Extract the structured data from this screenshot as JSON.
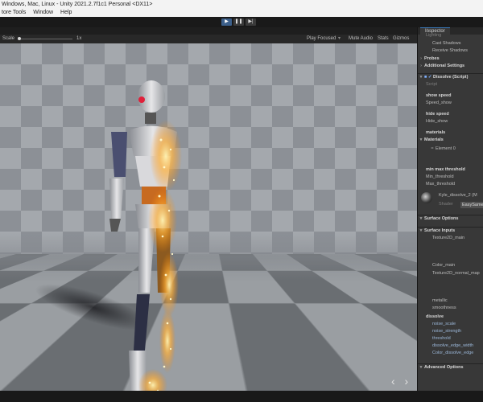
{
  "window": {
    "title": "Windows, Mac, Linux - Unity 2021.2.7f1c1 Personal <DX11>"
  },
  "menu": {
    "items": [
      "tore Tools",
      "Window",
      "Help"
    ]
  },
  "toolbar": {
    "play_icon": "▶",
    "pause_icon": "❚❚",
    "step_icon": "▶|"
  },
  "game_view": {
    "scale_label": "Scale",
    "scale_value": "1x",
    "play_focused": "Play Focused",
    "mute_audio": "Mute Audio",
    "stats": "Stats",
    "gizmos": "Gizmos",
    "nav_arrows": "‹ ›"
  },
  "inspector": {
    "tab_label": "Inspector",
    "more_icon": "⋮",
    "lighting": "Lighting",
    "cast_shadows": "Cast Shadows",
    "receive_shadows": "Receive Shadows",
    "probes": "Probes",
    "additional_settings": "Additional Settings",
    "dissolve_script": "Dissolve (Script)",
    "script_label": "Script",
    "show_speed_header": "show speed",
    "speed_show": "Speed_show",
    "hide_speed_header": "hide speed",
    "hide_show": "Hide_show",
    "materials_header": "materials",
    "materials_foldout": "Materials",
    "element_0": "Element 0",
    "min_max_threshold": "min max threshold",
    "min_threshold": "Min_threshold",
    "max_threshold": "Max_threshold",
    "material_name": "Kyle_dissolve_2 (M",
    "shader_label": "Shader",
    "shader_value": "EasySamen",
    "surface_options": "Surface Options",
    "surface_inputs": "Surface Inputs",
    "texture2d_main": "Texture2D_main",
    "color_main": "Color_main",
    "texture2d_normal_map": "Texture2D_normal_map",
    "metallic": "metallic",
    "smoothness": "smoothness",
    "dissolve_header": "dissolve",
    "noise_scale": "noise_scale",
    "noise_strength": "noise_strength",
    "threshold": "threshold",
    "dissolve_edge_width": "dissolve_edge_width",
    "color_dissolve_edge": "Color_dissolve_edge",
    "advanced_options": "Advanced Options"
  },
  "colors": {
    "accent": "#3c5f8a",
    "glow": "#ffb13a",
    "eye": "#e0203a"
  }
}
